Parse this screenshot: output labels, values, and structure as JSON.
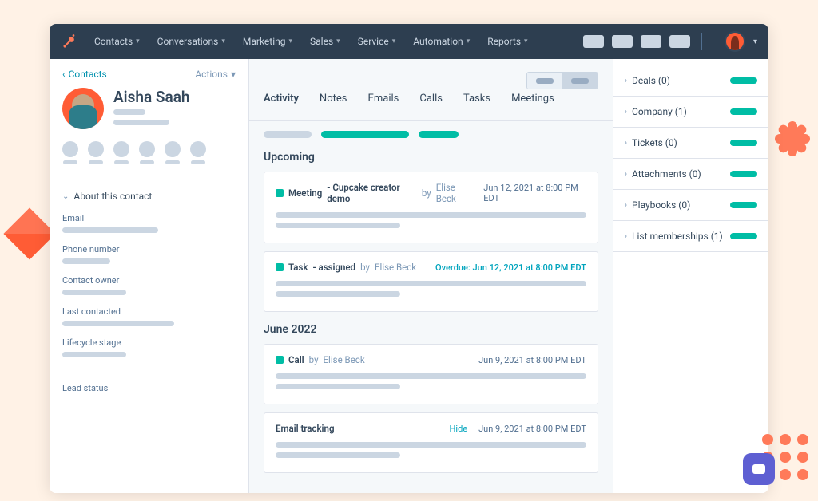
{
  "nav": {
    "items": [
      "Contacts",
      "Conversations",
      "Marketing",
      "Sales",
      "Service",
      "Automation",
      "Reports"
    ]
  },
  "left": {
    "back": "Contacts",
    "actions": "Actions",
    "name": "Aisha Saah",
    "about": "About this contact",
    "fields": {
      "email": "Email",
      "phone": "Phone number",
      "owner": "Contact owner",
      "last": "Last contacted",
      "stage": "Lifecycle stage",
      "lead": "Lead status"
    }
  },
  "center": {
    "tabs": [
      "Activity",
      "Notes",
      "Emails",
      "Calls",
      "Tasks",
      "Meetings"
    ],
    "upcoming_title": "Upcoming",
    "items": {
      "meeting": {
        "type": "Meeting",
        "title": " - Cupcake creator demo",
        "by_lbl": " by ",
        "by": "Elise Beck",
        "date": "Jun 12, 2021 at 8:00 PM EDT"
      },
      "task": {
        "type": "Task",
        "title": " - assigned",
        "by_lbl": " by ",
        "by": "Elise Beck",
        "overdue": "Overdue: Jun 12, 2021 at 8:00 PM EDT"
      }
    },
    "month": "June 2022",
    "call": {
      "type": "Call",
      "by_lbl": " by ",
      "by": "Elise Beck",
      "date": "Jun 9, 2021 at 8:00 PM EDT"
    },
    "email_tracking": {
      "title": "Email tracking",
      "hide": "Hide",
      "date": "Jun 9, 2021 at 8:00 PM EDT"
    }
  },
  "right": {
    "cards": [
      {
        "label": "Deals (0)"
      },
      {
        "label": "Company (1)"
      },
      {
        "label": "Tickets (0)"
      },
      {
        "label": "Attachments (0)"
      },
      {
        "label": "Playbooks (0)"
      },
      {
        "label": "List memberships (1)"
      }
    ]
  }
}
